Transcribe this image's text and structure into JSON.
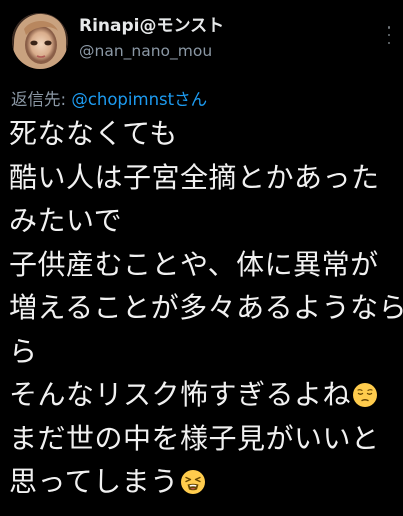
{
  "user": {
    "display_name": "Rinapi@モンスト",
    "handle": "@nan_nano_mou"
  },
  "reply": {
    "prefix": "返信先: ",
    "target": "@chopimnstさん"
  },
  "body_lines": [
    "死ななくても",
    "酷い人は子宮全摘とかあった",
    "みたいで",
    "子供産むことや、体に異常が",
    "増えることが多々あるようなら",
    "ら",
    "そんなリスク怖すぎるよね",
    "まだ世の中を様子見がいいと",
    "思ってしまう"
  ],
  "emojis": {
    "line_7": "pensive-face-emoji",
    "line_9": "tired-face-emoji"
  },
  "colors": {
    "background": "#000000",
    "text_primary": "#e7e9ea",
    "text_secondary": "#8b98a5",
    "link": "#1d9bf0"
  }
}
